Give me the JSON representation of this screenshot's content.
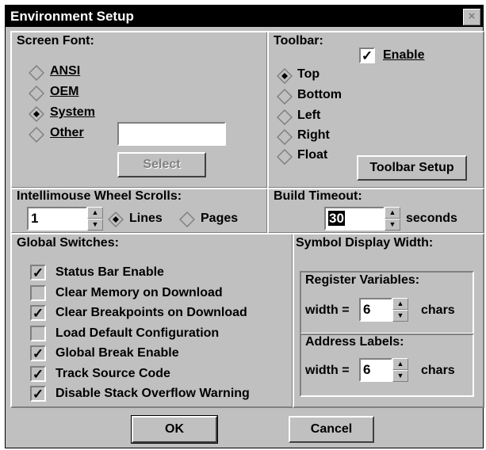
{
  "window": {
    "title": "Environment Setup",
    "close_glyph": "×"
  },
  "screen_font": {
    "label": "Screen Font:",
    "options": [
      {
        "label": "ANSI",
        "selected": false
      },
      {
        "label": "OEM",
        "selected": false
      },
      {
        "label": "System",
        "selected": true
      },
      {
        "label": "Other",
        "selected": false
      }
    ],
    "other_value": "",
    "select_label": "Select"
  },
  "toolbar": {
    "label": "Toolbar:",
    "enable_label": "Enable",
    "enabled": true,
    "options": [
      {
        "label": "Top",
        "selected": true
      },
      {
        "label": "Bottom",
        "selected": false
      },
      {
        "label": "Left",
        "selected": false
      },
      {
        "label": "Right",
        "selected": false
      },
      {
        "label": "Float",
        "selected": false
      }
    ],
    "setup_label": "Toolbar Setup"
  },
  "wheel": {
    "label": "Intellimouse Wheel Scrolls:",
    "value": "1",
    "lines_label": "Lines",
    "pages_label": "Pages",
    "selected": "Lines"
  },
  "build": {
    "label": "Build Timeout:",
    "value": "30",
    "unit": "seconds"
  },
  "global": {
    "label": "Global Switches:",
    "items": [
      {
        "label": "Status Bar Enable",
        "checked": true
      },
      {
        "label": "Clear Memory on Download",
        "checked": false
      },
      {
        "label": "Clear Breakpoints on Download",
        "checked": true
      },
      {
        "label": "Load Default Configuration",
        "checked": false
      },
      {
        "label": "Global Break Enable",
        "checked": true
      },
      {
        "label": "Track Source Code",
        "checked": true
      },
      {
        "label": "Disable Stack Overflow Warning",
        "checked": true
      }
    ]
  },
  "symbol": {
    "label": "Symbol Display Width:",
    "register": {
      "label": "Register Variables:",
      "prefix": "width =",
      "value": "6",
      "unit": "chars"
    },
    "address": {
      "label": "Address Labels:",
      "prefix": "width =",
      "value": "6",
      "unit": "chars"
    }
  },
  "buttons": {
    "ok": "OK",
    "cancel": "Cancel"
  },
  "check_glyph": "✓"
}
